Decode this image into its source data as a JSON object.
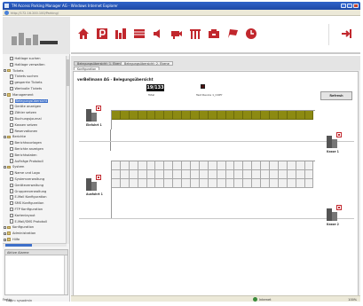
{
  "window": {
    "title": "TM Access Parking Manager AG - Windows Internet Explorer",
    "url": "http://172.16.200.100/Parking/"
  },
  "sidebar": {
    "tree": [
      {
        "label": "Haltlage suchen",
        "level": 2,
        "kind": "doc"
      },
      {
        "label": "Haltlage verwalten",
        "level": 2,
        "kind": "doc"
      },
      {
        "label": "Tickets",
        "level": 1,
        "kind": "folder",
        "expanded": true
      },
      {
        "label": "Tickets suchen",
        "level": 2,
        "kind": "doc"
      },
      {
        "label": "gesperrte Tickets",
        "level": 2,
        "kind": "doc"
      },
      {
        "label": "Wertvolle Tickets",
        "level": 2,
        "kind": "doc"
      },
      {
        "label": "Management",
        "level": 1,
        "kind": "folder",
        "expanded": true
      },
      {
        "label": "Belegungsübersicht",
        "level": 2,
        "kind": "doc",
        "selected": true
      },
      {
        "label": "Geräte anzeigen",
        "level": 2,
        "kind": "doc"
      },
      {
        "label": "Zähler setzen",
        "level": 2,
        "kind": "doc"
      },
      {
        "label": "Buchungsjournal",
        "level": 2,
        "kind": "doc"
      },
      {
        "label": "Kassen setzen",
        "level": 2,
        "kind": "doc"
      },
      {
        "label": "Reservationen",
        "level": 2,
        "kind": "doc"
      },
      {
        "label": "Berichte",
        "level": 1,
        "kind": "folder",
        "expanded": true
      },
      {
        "label": "Berichtsvorlagen",
        "level": 2,
        "kind": "doc"
      },
      {
        "label": "Berichte anzeigen",
        "level": 2,
        "kind": "doc"
      },
      {
        "label": "Berichtsdaten",
        "level": 2,
        "kind": "doc"
      },
      {
        "label": "Aufträge Protokoll",
        "level": 2,
        "kind": "doc"
      },
      {
        "label": "System",
        "level": 1,
        "kind": "folder",
        "expanded": true
      },
      {
        "label": "Name und Logo",
        "level": 2,
        "kind": "doc"
      },
      {
        "label": "Systemverwaltung",
        "level": 2,
        "kind": "doc"
      },
      {
        "label": "Geräteverwaltung",
        "level": 2,
        "kind": "doc"
      },
      {
        "label": "Gruppenverwaltung",
        "level": 2,
        "kind": "doc"
      },
      {
        "label": "E-Mail Konfiguration",
        "level": 2,
        "kind": "doc"
      },
      {
        "label": "SMS Konfiguration",
        "level": 2,
        "kind": "doc"
      },
      {
        "label": "FTP Konfiguration",
        "level": 2,
        "kind": "doc"
      },
      {
        "label": "Kartenlayout",
        "level": 2,
        "kind": "doc"
      },
      {
        "label": "E-Mail/SMS Protokoll",
        "level": 2,
        "kind": "doc"
      },
      {
        "label": "Konfiguration",
        "level": 1,
        "kind": "folder",
        "expanded": false
      },
      {
        "label": "Administration",
        "level": 1,
        "kind": "folder",
        "expanded": false
      },
      {
        "label": "Hilfe",
        "level": 1,
        "kind": "folder",
        "expanded": false
      }
    ],
    "alarm_header": "Aktive Alarme",
    "login_status": "Login: sysadmin"
  },
  "toolbar": {
    "icons": [
      "home-icon",
      "parking-icon",
      "occupancy-icon",
      "barrier-icon",
      "speaker-icon",
      "camera-icon",
      "gate-icon",
      "cash-icon",
      "flag-icon",
      "clock-icon",
      "logout-icon"
    ]
  },
  "tabs": {
    "items": [
      "Belegungsübersicht: 1. Ebene",
      "Belegungsübersicht: 2. Ebene"
    ],
    "active_index": 1,
    "subtab": "Konfiguration"
  },
  "panel": {
    "title": "verBellmann AG - Belegungsübersicht",
    "total_value": "19/133",
    "total_label": "Total",
    "test_device_label": "Test Device 1_COPY",
    "refresh_label": "Refresh"
  },
  "devices": {
    "einfahrt": "Einfahrt 1",
    "ausfahrt": "Ausfahrt 1",
    "kasse1": "Kasse 1",
    "kasse2": "Kasse 2"
  },
  "grids": {
    "occupied_cells": 23,
    "lower_rows": 3,
    "lower_cols": 23
  },
  "statusbar": {
    "left": "Fertig",
    "zone": "Internet",
    "zoom": "100%"
  },
  "colors": {
    "accent_red": "#c1272d",
    "occupied": "#8c8a12",
    "selected": "#3d6fc9"
  }
}
